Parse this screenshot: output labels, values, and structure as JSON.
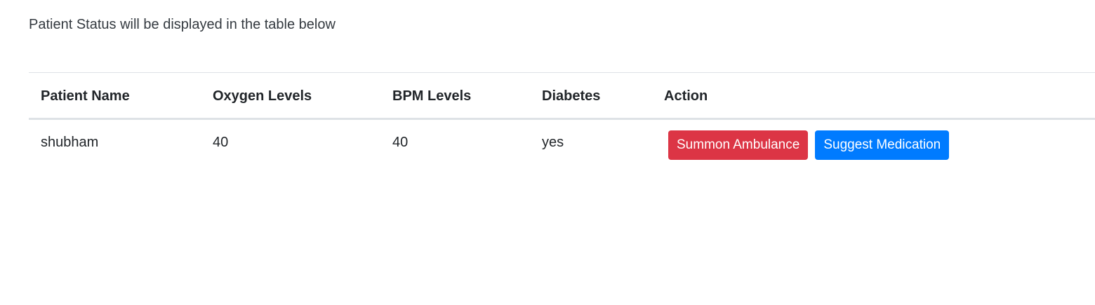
{
  "intro_text": "Patient Status will be displayed in the table below",
  "table": {
    "headers": [
      "Patient Name",
      "Oxygen Levels",
      "BPM Levels",
      "Diabetes",
      "Action"
    ],
    "rows": [
      {
        "patient_name": "shubham",
        "oxygen": "40",
        "bpm": "40",
        "diabetes": "yes",
        "actions": {
          "summon_label": "Summon Ambulance",
          "suggest_label": "Suggest Medication"
        }
      }
    ]
  },
  "colors": {
    "danger": "#dc3545",
    "primary": "#007bff",
    "border": "#dee2e6"
  }
}
